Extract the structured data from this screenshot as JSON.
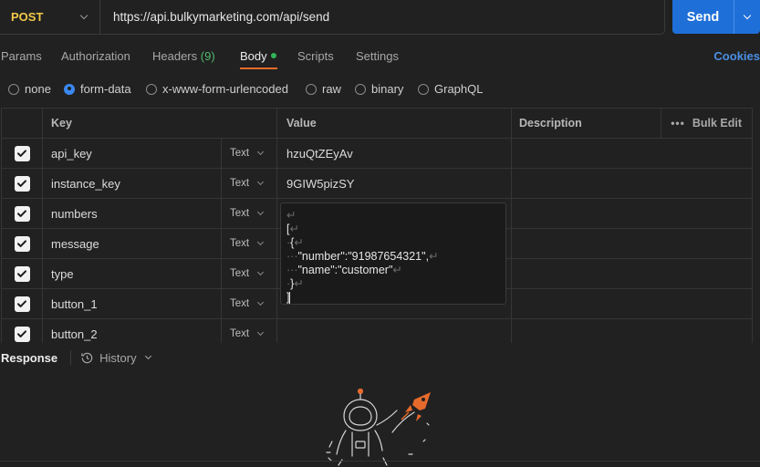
{
  "request": {
    "method": "POST",
    "url": "https://api.bulkymarketing.com/api/send",
    "send_label": "Send"
  },
  "tabs": [
    {
      "label": "Params"
    },
    {
      "label": "Authorization"
    },
    {
      "label": "Headers",
      "count": "(9)"
    },
    {
      "label": "Body",
      "active": true,
      "dot_color": "#2fb45a"
    },
    {
      "label": "Scripts"
    },
    {
      "label": "Settings"
    }
  ],
  "cookies_label": "Cookies",
  "body_types": [
    {
      "label": "none",
      "checked": false
    },
    {
      "label": "form-data",
      "checked": true
    },
    {
      "label": "x-www-form-urlencoded",
      "checked": false
    },
    {
      "label": "raw",
      "checked": false
    },
    {
      "label": "binary",
      "checked": false
    },
    {
      "label": "GraphQL",
      "checked": false
    }
  ],
  "table": {
    "headers": {
      "key": "Key",
      "value": "Value",
      "description": "Description",
      "bulk_edit": "Bulk Edit"
    },
    "rows": [
      {
        "key": "api_key",
        "type": "Text",
        "value": "hzuQtZEyAv",
        "checked": true
      },
      {
        "key": "instance_key",
        "type": "Text",
        "value": "9GIW5pizSY",
        "checked": true
      },
      {
        "key": "numbers",
        "type": "Text",
        "value": "",
        "checked": true
      },
      {
        "key": "message",
        "type": "Text",
        "value": "",
        "checked": true
      },
      {
        "key": "type",
        "type": "Text",
        "value": "",
        "checked": true
      },
      {
        "key": "button_1",
        "type": "Text",
        "value": "",
        "checked": true
      },
      {
        "key": "button_2",
        "type": "Text",
        "value": "",
        "checked": true
      }
    ]
  },
  "json_editor": {
    "lines": [
      {
        "ws": "",
        "text": "",
        "nl": "↵"
      },
      {
        "ws": "",
        "text": "[",
        "nl": "↵"
      },
      {
        "ws": "·",
        "text": "{",
        "nl": "↵"
      },
      {
        "ws": "···",
        "text": "\"number\":\"91987654321\",",
        "nl": "↵"
      },
      {
        "ws": "···",
        "text": "\"name\":\"customer\"",
        "nl": "↵"
      },
      {
        "ws": "·",
        "text": "}",
        "nl": "↵"
      },
      {
        "ws": "",
        "text": "]",
        "nl": ""
      }
    ]
  },
  "response": {
    "label": "Response",
    "history_label": "History"
  },
  "colors": {
    "method": "#f0c94a",
    "send": "#1f6fd8",
    "accent": "#e66a2c",
    "checked_radio": "#3a88f0"
  }
}
